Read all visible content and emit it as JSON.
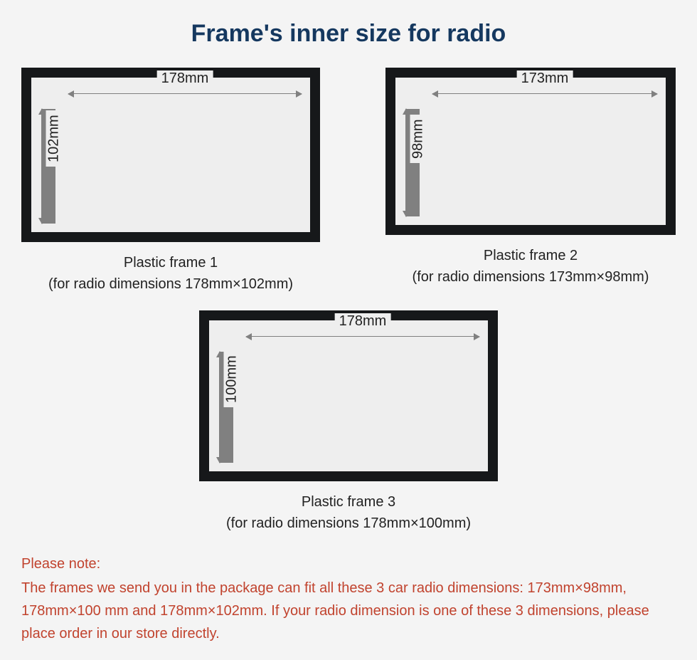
{
  "title": "Frame's inner size for radio",
  "frames": [
    {
      "width_label": "178mm",
      "height_label": "102mm",
      "name": "Plastic frame 1",
      "desc": "(for radio dimensions 178mm×102mm)"
    },
    {
      "width_label": "173mm",
      "height_label": "98mm",
      "name": "Plastic frame 2",
      "desc": "(for radio dimensions 173mm×98mm)"
    },
    {
      "width_label": "178mm",
      "height_label": "100mm",
      "name": "Plastic frame 3",
      "desc": "(for radio dimensions 178mm×100mm)"
    }
  ],
  "note": {
    "head": "Please note:",
    "body": "The frames we send you in the package can fit all these 3 car radio dimensions: 173mm×98mm,  178mm×100 mm and  178mm×102mm. If your radio dimension is one of these 3 dimensions, please place order in our store directly."
  }
}
